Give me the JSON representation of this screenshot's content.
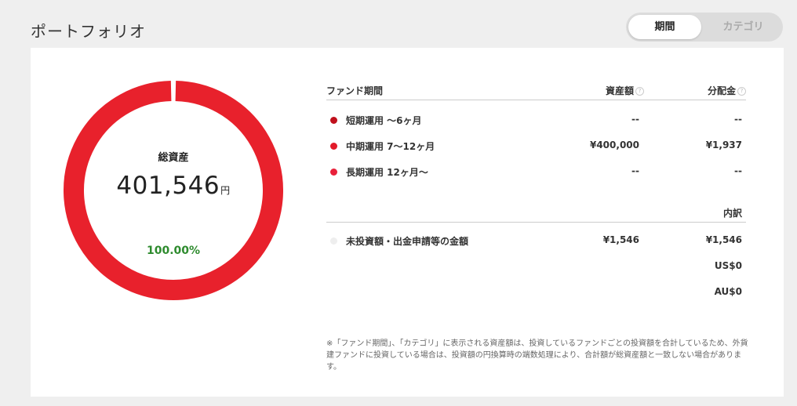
{
  "page": {
    "title": "ポートフォリオ"
  },
  "toggle": {
    "period": "期間",
    "category": "カテゴリ"
  },
  "chart_data": {
    "type": "pie",
    "title": "総資産",
    "total": "401,546",
    "unit": "円",
    "percent": "100.00%",
    "categories": [
      "短期運用 〜6ヶ月",
      "中期運用 7〜12ヶ月",
      "長期運用 12ヶ月〜"
    ],
    "values": [
      0,
      400000,
      0
    ],
    "colors": [
      "#d01020",
      "#e8212c",
      "#e8212c"
    ]
  },
  "table": {
    "headers": {
      "fund_period": "ファンド期間",
      "asset": "資産額",
      "distribution": "分配金",
      "help_icon": "?"
    },
    "rows": [
      {
        "name": "短期運用 〜6ヶ月",
        "asset": "--",
        "distribution": "--",
        "color": "#c0101c"
      },
      {
        "name": "中期運用 7〜12ヶ月",
        "asset": "¥400,000",
        "distribution": "¥1,937",
        "color": "#e21b2a"
      },
      {
        "name": "長期運用 12ヶ月〜",
        "asset": "--",
        "distribution": "--",
        "color": "#e8213a"
      }
    ],
    "breakdown_header": "内訳",
    "uninvested": {
      "name": "未投資額・出金申請等の金額",
      "asset": "¥1,546",
      "jpy": "¥1,546",
      "usd": "US$0",
      "aud": "AU$0",
      "color": "#eeeeee"
    }
  },
  "note": "※「ファンド期間」、「カテゴリ」に表示される資産額は、投資しているファンドごとの投資額を合計しているため、外貨建ファンドに投資している場合は、投資額の円換算時の端数処理により、合計額が総資産額と一致しない場合があります。"
}
